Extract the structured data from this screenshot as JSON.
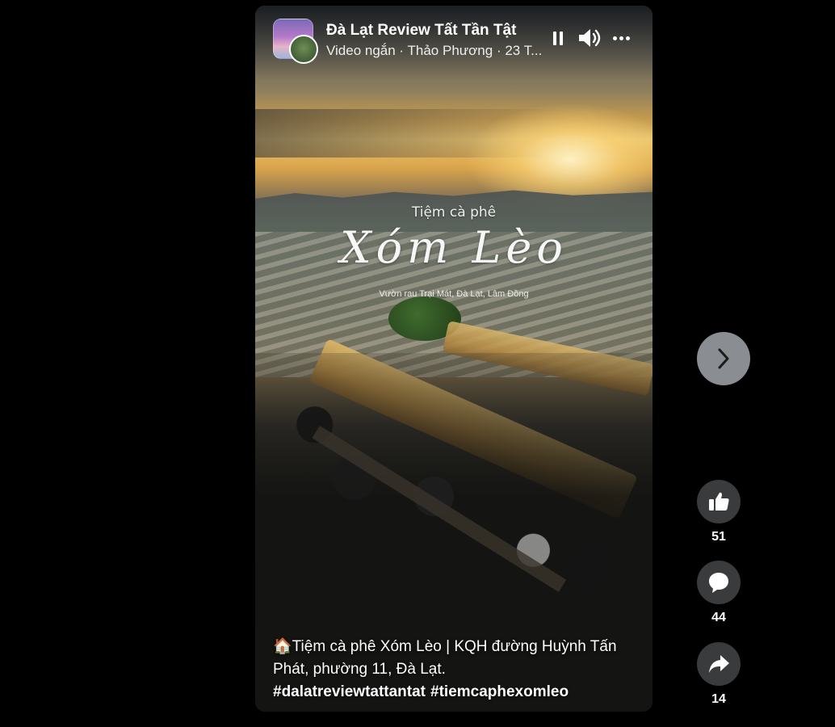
{
  "header": {
    "page_name": "Đà Lạt Review Tất Tần Tật",
    "meta": "Video ngắn · Thảo Phương · 23 T..."
  },
  "overlay": {
    "subtitle": "Tiệm cà phê",
    "title": "Xóm Lèo",
    "location": "Vườn rau Trại Mát, Đà Lạt, Lâm Đồng"
  },
  "caption": {
    "text": "🏠Tiệm cà phê Xóm Lèo | KQH đường Huỳnh Tấn Phát, phường 11, Đà Lạt.",
    "hashtags": [
      "#dalatreviewtattantat",
      "#tiemcaphexomleo"
    ]
  },
  "actions": {
    "likes": "51",
    "comments": "44",
    "shares": "14"
  },
  "icons": {
    "pause": "pause-icon",
    "volume": "volume-icon",
    "more": "more-icon",
    "next": "chevron-right-icon",
    "like": "thumbs-up-icon",
    "comment": "comment-icon",
    "share": "share-icon"
  },
  "colors": {
    "background": "#000000",
    "action_circle": "#3a3b3c",
    "next_circle": "#8a8d91"
  }
}
